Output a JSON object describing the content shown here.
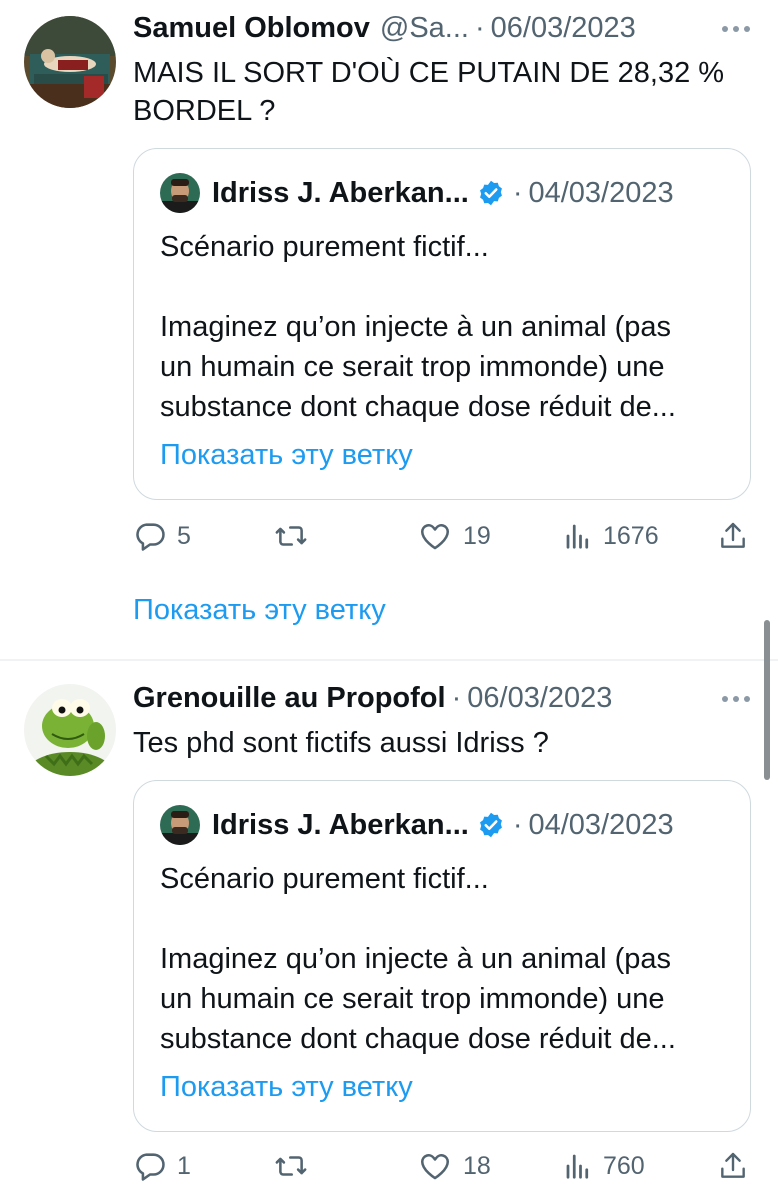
{
  "tweets": [
    {
      "author_name": "Samuel Oblomov",
      "author_handle": "@Sa...",
      "separator": "·",
      "date": "06/03/2023",
      "text_lines": [
        "MAIS IL SORT D'OÙ CE PUTAIN DE 28,32 %",
        "BORDEL ?"
      ],
      "quote": {
        "author_name": "Idriss J. Aberkan...",
        "separator": "·",
        "date": "04/03/2023",
        "line1": "Scénario purement fictif...",
        "line2": "Imaginez qu’on injecte à un animal (pas",
        "line3": "un humain ce serait trop immonde) une",
        "line4": "substance dont chaque dose réduit de...",
        "show_thread": "Показать эту ветку"
      },
      "stats": {
        "replies": "5",
        "retweets": "",
        "likes": "19",
        "views": "1676"
      },
      "show_thread": "Показать эту ветку"
    },
    {
      "author_name": "Grenouille au Propofol",
      "separator": "·",
      "date": "06/03/2023",
      "text": "Tes phd sont fictifs aussi Idriss ?",
      "quote": {
        "author_name": "Idriss J. Aberkan...",
        "separator": "·",
        "date": "04/03/2023",
        "line1": "Scénario purement fictif...",
        "line2": "Imaginez qu’on injecte à un animal (pas",
        "line3": "un humain ce serait trop immonde) une",
        "line4": "substance dont chaque dose réduit de...",
        "show_thread": "Показать эту ветку"
      },
      "stats": {
        "replies": "1",
        "retweets": "",
        "likes": "18",
        "views": "760"
      }
    }
  ],
  "icons": {
    "reply": "reply-icon",
    "retweet": "retweet-icon",
    "like": "heart-icon",
    "views": "views-icon",
    "share": "share-icon",
    "more": "more-icon",
    "verified": "verified-badge-icon"
  },
  "colors": {
    "link": "#1d9bf0",
    "secondary_text": "#536471",
    "verified": "#1d9bf0",
    "border": "#cfd9de"
  }
}
